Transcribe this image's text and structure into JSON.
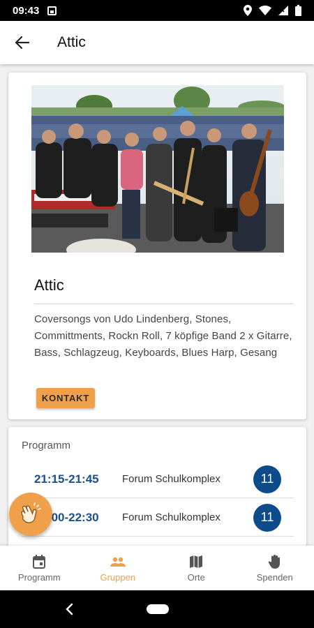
{
  "status_bar": {
    "time": "09:43"
  },
  "app_bar": {
    "title": "Attic"
  },
  "group": {
    "name": "Attic",
    "description": "Coversongs von Udo Lindenberg, Stones, Committments, Rockn Roll, 7 köpfige Band 2 x Gitarre, Bass, Schlagzeug, Keyboards, Blues Harp, Gesang",
    "contact_label": "KONTAKT"
  },
  "program": {
    "title": "Programm",
    "rows": [
      {
        "time": "21:15-21:45",
        "place": "Forum Schulkomplex",
        "badge": "11"
      },
      {
        "time": "22:00-22:30",
        "place": "Forum Schulkomplex",
        "badge": "11"
      }
    ]
  },
  "bottom_nav": {
    "items": [
      {
        "label": "Programm",
        "icon": "calendar-icon"
      },
      {
        "label": "Gruppen",
        "icon": "people-icon"
      },
      {
        "label": "Orte",
        "icon": "map-icon"
      },
      {
        "label": "Spenden",
        "icon": "hand-icon"
      }
    ],
    "active_index": 1
  },
  "colors": {
    "accent": "#f0a04a",
    "badge": "#0d4b8a",
    "time_text": "#1d4f8c"
  }
}
